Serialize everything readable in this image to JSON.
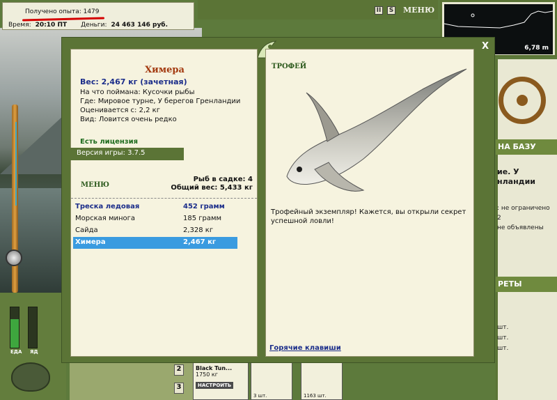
{
  "hud": {
    "xp": "Получено опыта: 1479",
    "time_label": "Время:",
    "time_value": "20:10 ПТ",
    "money_label": "Деньги:",
    "money_value": "24 463 146 руб.",
    "menu_label": "МЕНЮ",
    "pause_glyph": "II",
    "sound_glyph": "S",
    "depth": "6,78 m"
  },
  "right_panel": {
    "header": "НА БАЗУ",
    "partial1": "ие. У",
    "partial2": "нландии",
    "partial3": ": не ограничено",
    "partial4": "2",
    "partial5": "не объявлены",
    "section": "РЕТЫ",
    "partial6": "шт.",
    "partial7": "шт.",
    "partial8": "шт."
  },
  "bars": {
    "food_label": "ЕДА",
    "poison_label": "ЯД",
    "food_level": 0.7,
    "poison_level": 0.0
  },
  "bottom": {
    "num2": "2",
    "num3": "3",
    "bait_name": "Black Tun...",
    "bait_weight": "1750 кг",
    "setup_button": "НАСТРОИТЬ",
    "slot1_count": "3 шт.",
    "slot2_count": "1163 шт."
  },
  "modal": {
    "close": "X",
    "fish_name": "Химера",
    "weight": "Вес: 2,467 кг (зачетная)",
    "caught_on": "На что поймана: Кусочки рыбы",
    "where": "Где: Мировое турне, У берегов Гренландии",
    "value": "Оценивается с: 2,2 кг",
    "species": "Вид: Ловится очень редко",
    "license": "Есть лицензия",
    "version": "Версия игры: 3.7.5",
    "menu": "МЕНЮ",
    "cage_count": "Рыб в садке: 4",
    "cage_weight": "Общий вес: 5,433 кг",
    "catch_list": [
      {
        "name": "Треска ледовая",
        "weight": "452 грамм"
      },
      {
        "name": "Морская минога",
        "weight": "185 грамм"
      },
      {
        "name": "Сайда",
        "weight": "2,328 кг"
      },
      {
        "name": "Химера",
        "weight": "2,467 кг"
      }
    ],
    "trophy_title": "ТРОФЕЙ",
    "trophy_text": "Трофейный экземпляр! Кажется, вы открыли секрет успешной ловли!",
    "hotkeys": "Горячие клавиши"
  }
}
